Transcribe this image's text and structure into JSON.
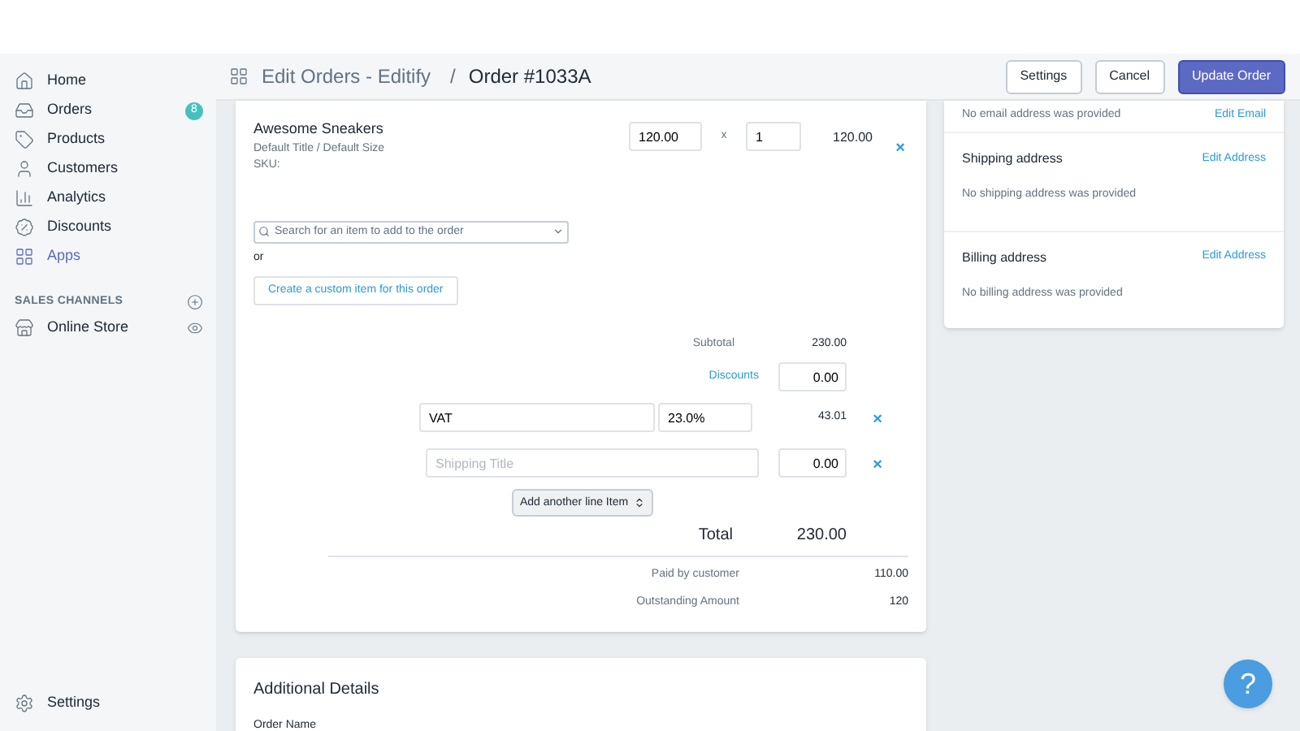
{
  "sidebar": {
    "items": [
      {
        "kind": "home",
        "label": "Home",
        "selected": false
      },
      {
        "kind": "orders",
        "label": "Orders",
        "selected": false,
        "badge": "8"
      },
      {
        "kind": "products",
        "label": "Products",
        "selected": false
      },
      {
        "kind": "customers",
        "label": "Customers",
        "selected": false
      },
      {
        "kind": "analytics",
        "label": "Analytics",
        "selected": false
      },
      {
        "kind": "discounts",
        "label": "Discounts",
        "selected": false
      },
      {
        "kind": "apps",
        "label": "Apps",
        "selected": true
      }
    ],
    "section_title": "SALES CHANNELS",
    "channels": [
      {
        "label": "Online Store"
      }
    ],
    "settings": "Settings"
  },
  "header": {
    "app": "Edit Orders - Editify",
    "separator": "/",
    "title": "Order #1033A",
    "buttons": [
      {
        "label": "Settings",
        "kind": "secondary"
      },
      {
        "label": "Cancel",
        "kind": "secondary"
      },
      {
        "label": "Update Order",
        "kind": "primary"
      }
    ]
  },
  "line_item": {
    "name": "Awesome Sneakers",
    "variant": "Default Title / Default Size",
    "sku": "SKU:",
    "price": "120.00",
    "times": "x",
    "quantity": "1",
    "total": "120.00",
    "remove": "×"
  },
  "search": {
    "placeholder": "Search for an item to add to the order"
  },
  "or": "or",
  "custom_button": "Create a custom item for this order",
  "summary": {
    "subtotal_label": "Subtotal",
    "subtotal": "230.00",
    "discounts_label": "Discounts",
    "discounts": "0.00",
    "lines": [
      {
        "kind": "tax",
        "title": "VAT",
        "rate": "23.0%",
        "amount": "43.01",
        "remove": "×"
      },
      {
        "kind": "shipping",
        "placeholder": "Shipping Title",
        "amount": "0.00",
        "remove": "×"
      }
    ],
    "add_line": "Add another line Item",
    "total_label": "Total",
    "total": "230.00",
    "paid_label": "Paid by customer",
    "paid": "110.00",
    "outstanding_label": "Outstanding Amount",
    "outstanding": "120"
  },
  "customer_panel": {
    "email": {
      "text": "No email address was provided",
      "action": "Edit Email"
    },
    "sections": [
      {
        "title": "Shipping address",
        "action": "Edit Address",
        "text": "No shipping address was provided"
      },
      {
        "title": "Billing address",
        "action": "Edit Address",
        "text": "No billing address was provided"
      }
    ]
  },
  "additional": {
    "title": "Additional Details",
    "field_label": "Order Name"
  },
  "help": "?"
}
